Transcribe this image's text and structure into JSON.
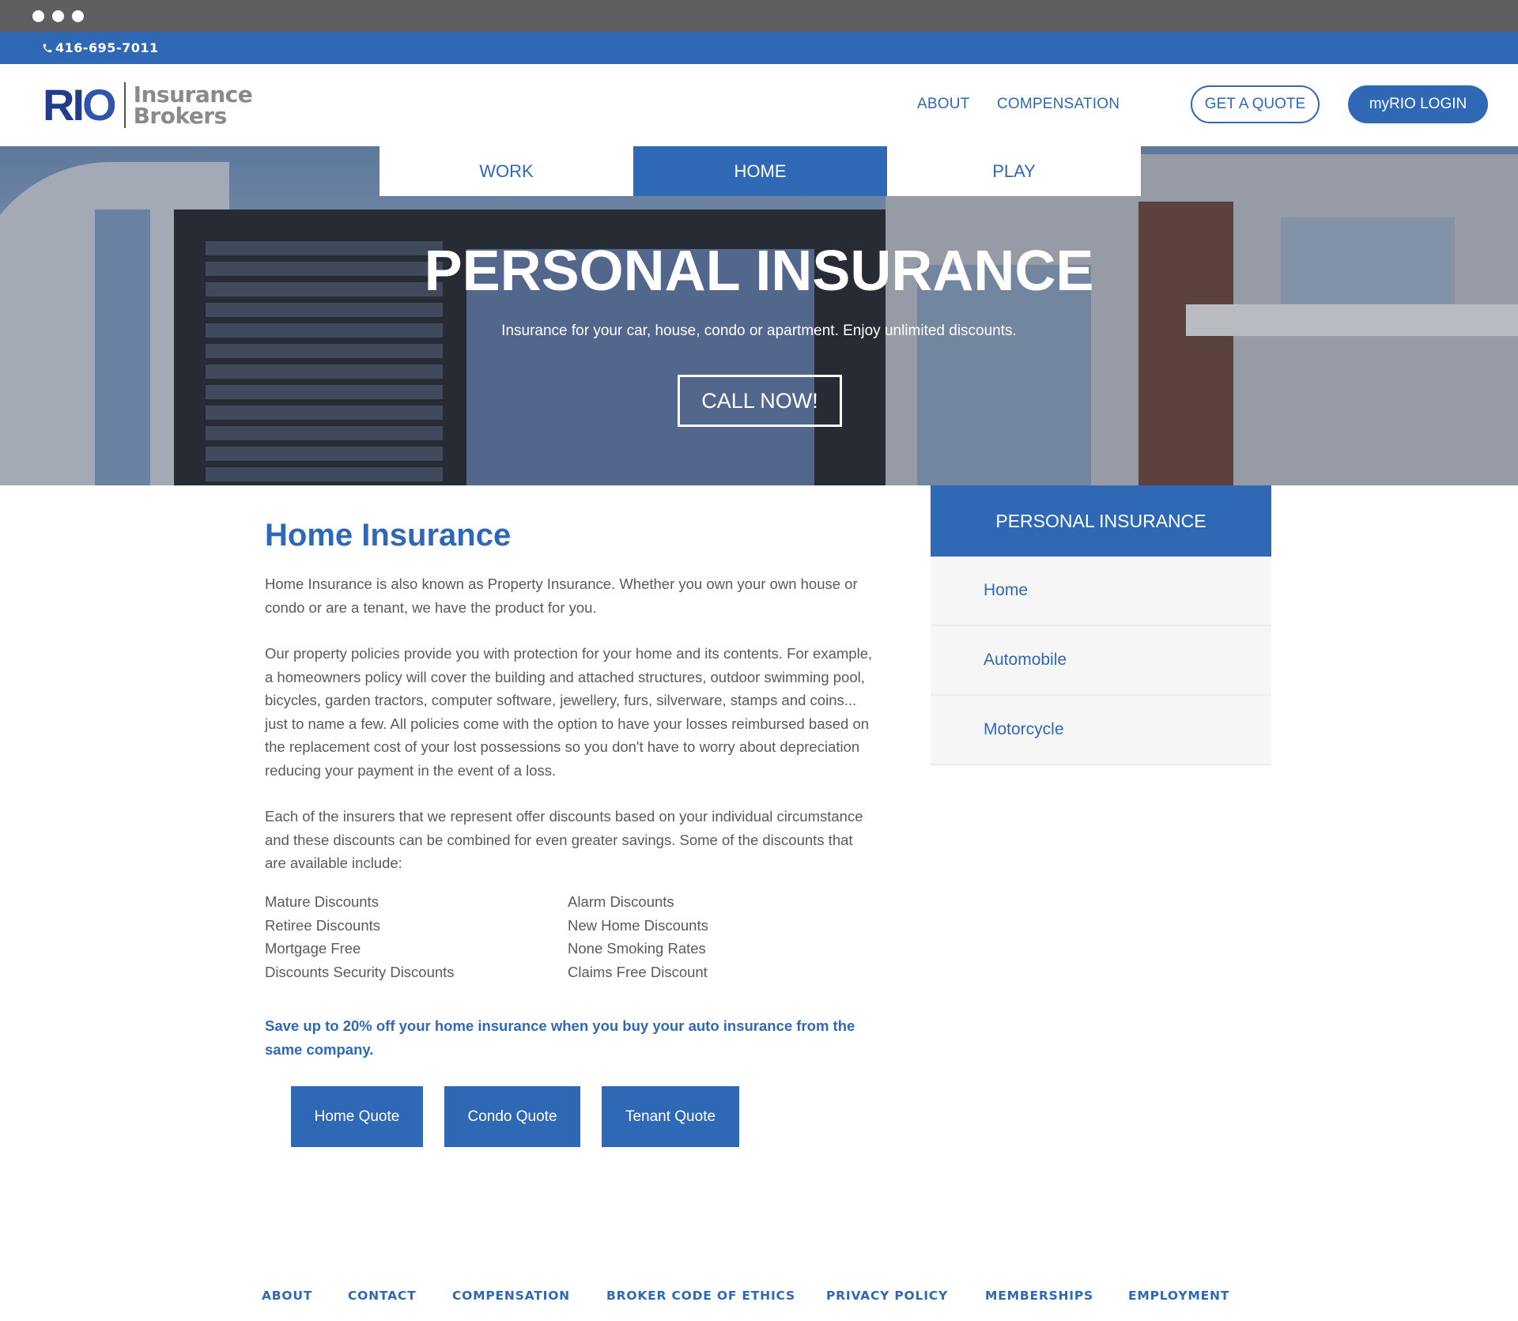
{
  "topbar": {
    "phone": "416-695-7011"
  },
  "header": {
    "logo_mark": "RIO",
    "logo_line1": "Insurance",
    "logo_line2": "Brokers",
    "nav": [
      "ABOUT",
      "COMPENSATION"
    ],
    "get_quote": "GET A QUOTE",
    "login": "myRIO LOGIN"
  },
  "tabs": [
    {
      "label": "WORK",
      "active": false
    },
    {
      "label": "HOME",
      "active": true
    },
    {
      "label": "PLAY",
      "active": false
    }
  ],
  "hero": {
    "title": "PERSONAL INSURANCE",
    "subtitle": "Insurance for your car, house, condo or apartment. Enjoy unlimited discounts.",
    "cta": "CALL NOW!"
  },
  "main": {
    "title": "Home Insurance",
    "p1": "Home Insurance is also known as Property Insurance. Whether you own your own house or condo or are a tenant, we have the product for you.",
    "p2": "Our property policies provide you with protection for your home and its contents. For example, a homeowners policy will cover the building and attached structures, outdoor swimming pool, bicycles, garden tractors, computer software, jewellery, furs, silverware, stamps and coins... just to name a few. All policies come with the option to have your losses reimbursed based on the replacement cost of your lost possessions so you don't have to worry about depreciation reducing your payment in the event of a loss.",
    "p3": "Each of the insurers that we represent offer discounts based on your individual circumstance and these discounts can be combined for even greater savings. Some of the discounts that are available include:",
    "discounts_left": [
      "Mature Discounts",
      "Retiree Discounts",
      "Mortgage Free",
      "Discounts Security Discounts"
    ],
    "discounts_right": [
      "Alarm Discounts",
      "New Home Discounts",
      "None Smoking Rates",
      "Claims Free Discount"
    ],
    "save_note": "Save up to 20% off your home insurance when you buy your auto insurance from the same company.",
    "quote_buttons": [
      "Home Quote",
      "Condo Quote",
      "Tenant Quote"
    ]
  },
  "sidebar": {
    "heading": "PERSONAL INSURANCE",
    "items": [
      "Home",
      "Automobile",
      "Motorcycle"
    ]
  },
  "footer": {
    "links": [
      "ABOUT",
      "CONTACT",
      "COMPENSATION",
      "BROKER CODE OF ETHICS",
      "PRIVACY POLICY",
      "MEMBERSHIPS",
      "EMPLOYMENT"
    ]
  },
  "colors": {
    "brand_blue": "#2f69b6",
    "logo_navy": "#233d8d",
    "chrome": "#5f5f5f"
  },
  "icons": {
    "phone": "phone-icon"
  }
}
